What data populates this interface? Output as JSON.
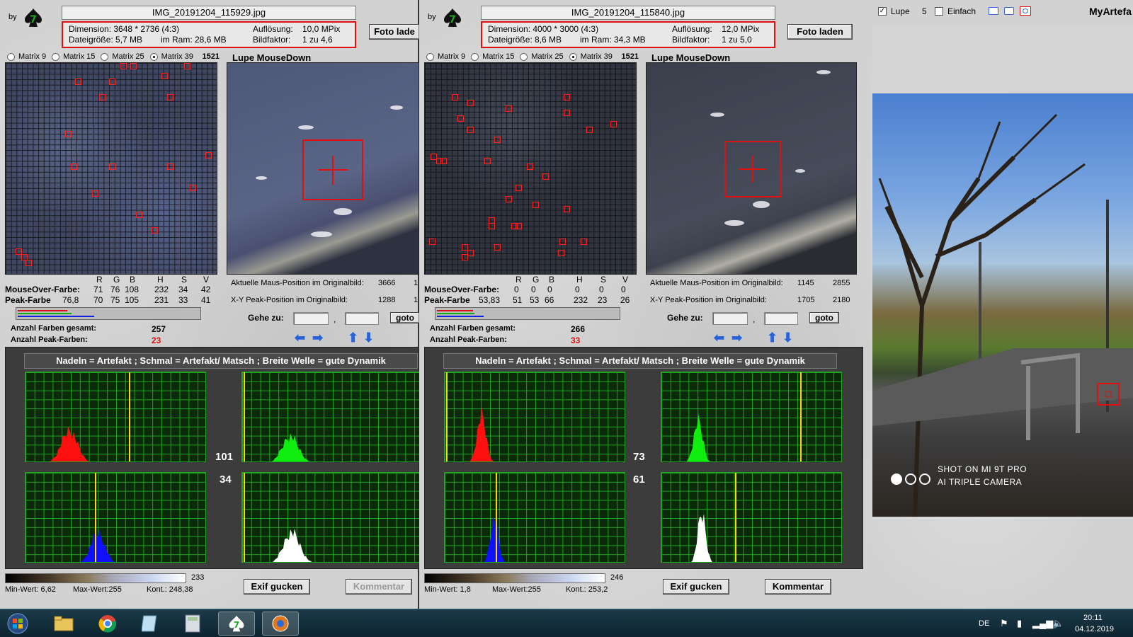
{
  "brand": {
    "by_label": "by"
  },
  "window1": {
    "filename": "IMG_20191204_115929.jpg",
    "dimension": "Dimension: 3648 * 2736 (4:3)",
    "resolution_label": "Auflösung:",
    "resolution_value": "10,0 MPix",
    "filesize": "Dateigröße: 5,7 MB",
    "ram": "im Ram: 28,6 MB",
    "factor_label": "Bildfaktor:",
    "factor_value": "1 zu 4,6",
    "load_button": "Foto lade",
    "matrix_options": [
      "Matrix 9",
      "Matrix 15",
      "Matrix 25",
      "Matrix 39"
    ],
    "matrix_count": "1521",
    "lupe_title": "Lupe MouseDown",
    "cols": [
      "R",
      "G",
      "B",
      "H",
      "S",
      "V"
    ],
    "mouseover_label": "MouseOver-Farbe:",
    "mouseover_values": [
      "71",
      "76",
      "108",
      "232",
      "34",
      "42"
    ],
    "peak_label": "Peak-Farbe",
    "peak_extra": "76,8",
    "peak_values": [
      "70",
      "75",
      "105",
      "231",
      "33",
      "41"
    ],
    "mouse_pos_label": "Aktuelle Maus-Position  im Originalbild:",
    "mouse_pos_x": "3666",
    "mouse_pos_y": "1",
    "peak_pos_label": "X-Y Peak-Position  im Originalbild:",
    "peak_pos_x": "1288",
    "peak_pos_y": "1",
    "goto_label": "Gehe zu:",
    "goto_comma": ",",
    "goto_button": "goto",
    "colors_total_label": "Anzahl Farben gesamt:",
    "colors_total": "257",
    "peak_colors_label": "Anzahl Peak-Farben:",
    "peak_colors": "23",
    "banner": "Nadeln = Artefakt ; Schmal = Artefakt/ Matsch  ;  Breite Welle = gute Dynamik",
    "hist_num_top": "101",
    "hist_num_bottom": "34",
    "grad_max": "233",
    "min_label": "Min-Wert: 6,62",
    "max_label": "Max-Wert:255",
    "kont_label": "Kont.: 248,38",
    "exif_button": "Exif gucken",
    "comment_button": "Kommentar"
  },
  "window2": {
    "filename": "IMG_20191204_115840.jpg",
    "dimension": "Dimension: 4000 * 3000 (4:3)",
    "resolution_label": "Auflösung:",
    "resolution_value": "12,0 MPix",
    "filesize": "Dateigröße: 8,6 MB",
    "ram": "im Ram: 34,3 MB",
    "factor_label": "Bildfaktor:",
    "factor_value": "1 zu 5,0",
    "load_button": "Foto laden",
    "matrix_options": [
      "Matrix 9",
      "Matrix 15",
      "Matrix 25",
      "Matrix 39"
    ],
    "matrix_count": "1521",
    "lupe_title": "Lupe MouseDown",
    "cols": [
      "R",
      "G",
      "B",
      "H",
      "S",
      "V"
    ],
    "mouseover_label": "MouseOver-Farbe:",
    "mouseover_values": [
      "0",
      "0",
      "0",
      "0",
      "0",
      "0"
    ],
    "peak_label": "Peak-Farbe",
    "peak_extra": "53,83",
    "peak_values": [
      "51",
      "53",
      "66",
      "232",
      "23",
      "26"
    ],
    "mouse_pos_label": "Aktuelle Maus-Position  im Originalbild:",
    "mouse_pos_x": "1145",
    "mouse_pos_y": "2855",
    "peak_pos_label": "X-Y Peak-Position  im Originalbild:",
    "peak_pos_x": "1705",
    "peak_pos_y": "2180",
    "goto_label": "Gehe zu:",
    "goto_comma": ",",
    "goto_button": "goto",
    "colors_total_label": "Anzahl Farben gesamt:",
    "colors_total": "266",
    "peak_colors_label": "Anzahl Peak-Farben:",
    "peak_colors": "33",
    "banner": "Nadeln = Artefakt ; Schmal = Artefakt/ Matsch  ;  Breite Welle = gute Dynamik",
    "hist_num_top": "73",
    "hist_num_bottom": "61",
    "grad_max": "246",
    "min_label": "Min-Wert: 1,8",
    "max_label": "Max-Wert:255",
    "kont_label": "Kont.: 253,2",
    "exif_button": "Exif gucken",
    "comment_button": "Kommentar"
  },
  "window3": {
    "lupe_label": "Lupe",
    "lupe_value": "5",
    "einfach_label": "Einfach",
    "title": "MyArtefa",
    "watermark_line1": "SHOT ON MI 9T PRO",
    "watermark_line2": "AI TRIPLE CAMERA"
  },
  "taskbar": {
    "lang": "DE",
    "time": "20:11",
    "date": "04.12.2019"
  },
  "colors": {
    "accent_red": "#e01010",
    "hist_grid": "#1fa51f",
    "peak_red": "#e01010"
  }
}
